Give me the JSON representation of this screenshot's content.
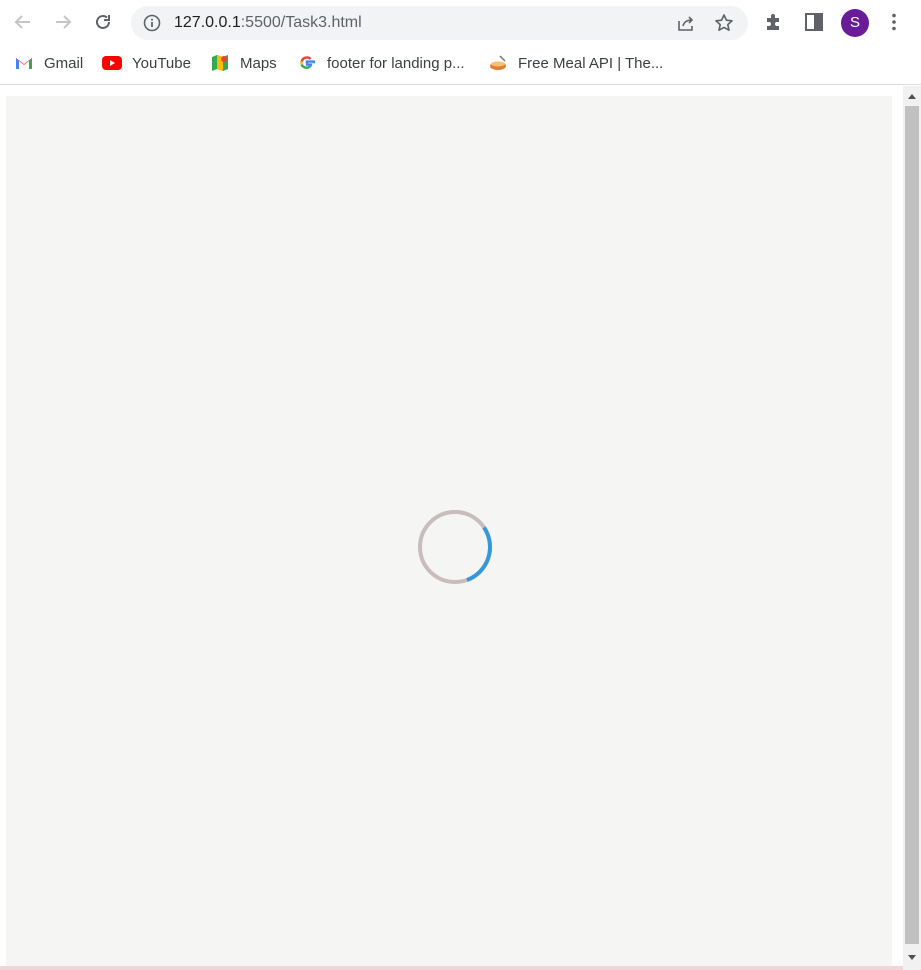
{
  "browser": {
    "url_host": "127.0.0.1",
    "url_path": ":5500/Task3.html",
    "profile_initial": "S",
    "colors": {
      "avatar": "#6a1b9a",
      "spinner_track": "#c9bcbc",
      "spinner_arc": "#3498db",
      "page_background": "#f5f5f4"
    }
  },
  "bookmarks": [
    {
      "label": "Gmail",
      "icon": "gmail-icon"
    },
    {
      "label": "YouTube",
      "icon": "youtube-icon"
    },
    {
      "label": "Maps",
      "icon": "maps-icon"
    },
    {
      "label": "footer for landing p...",
      "icon": "google-icon"
    },
    {
      "label": "Free Meal API | The...",
      "icon": "meal-icon"
    }
  ],
  "page": {
    "state": "loading",
    "spinner_icon": "loading-spinner-icon"
  }
}
